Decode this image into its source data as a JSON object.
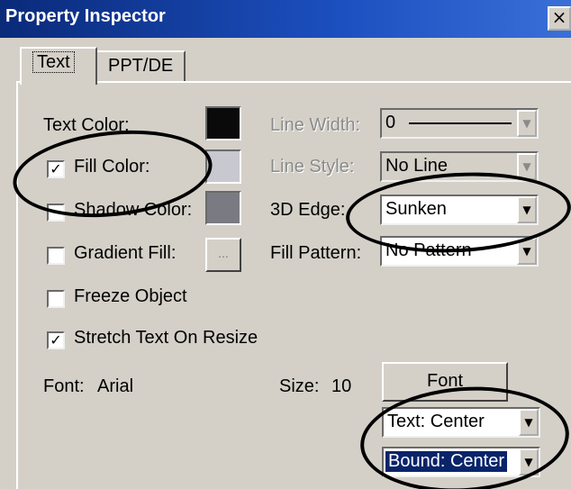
{
  "window": {
    "title": "Property Inspector",
    "close_label": "×"
  },
  "tabs": [
    {
      "label": "Text",
      "active": true
    },
    {
      "label": "PPT/DE",
      "active": false
    }
  ],
  "left": {
    "text_color": {
      "label": "Text Color:",
      "color": "#0a0a0a"
    },
    "fill_color": {
      "label": "Fill Color:",
      "checked": true,
      "check_glyph": "✓",
      "color": "#c8c8d0"
    },
    "shadow_color": {
      "label": "Shadow Color:",
      "checked": false,
      "color": "#7a7a82"
    },
    "gradient_fill": {
      "label": "Gradient Fill:",
      "checked": false,
      "button_label": "..."
    },
    "freeze_object": {
      "label": "Freeze Object",
      "checked": false
    },
    "stretch_text": {
      "label": "Stretch Text On Resize",
      "checked": true,
      "check_glyph": "✓"
    }
  },
  "right": {
    "line_width": {
      "label": "Line Width:",
      "value": "0",
      "enabled": false
    },
    "line_style": {
      "label": "Line Style:",
      "value": "No Line",
      "enabled": false
    },
    "edge_3d": {
      "label": "3D Edge:",
      "value": "Sunken",
      "enabled": true
    },
    "fill_pattern": {
      "label": "Fill Pattern:",
      "value": "No Pattern",
      "enabled": true
    }
  },
  "font": {
    "font_label": "Font:",
    "font_value": "Arial",
    "size_label": "Size:",
    "size_value": "10",
    "button_label": "Font"
  },
  "alignment": {
    "text_align": "Text: Center",
    "bound_align": "Bound: Center"
  },
  "icons": {
    "dropdown_arrow": "▼"
  }
}
